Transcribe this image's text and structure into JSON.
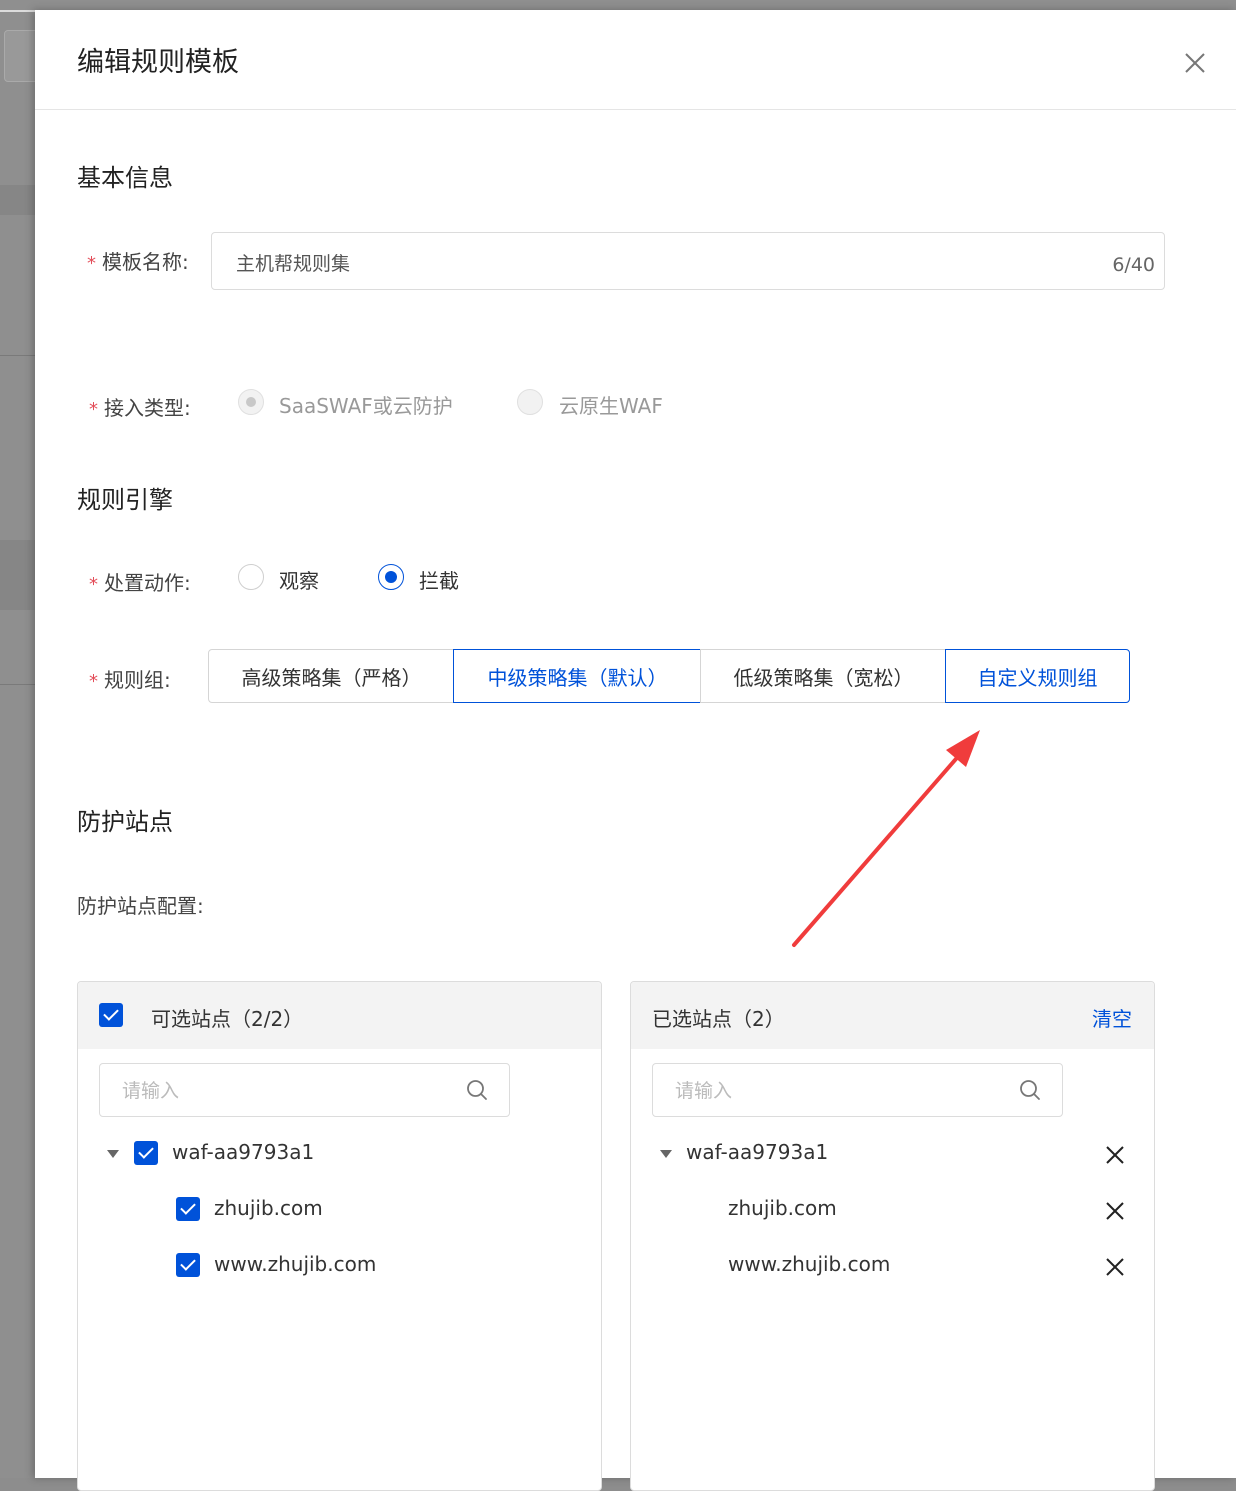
{
  "drawer": {
    "title": "编辑规则模板"
  },
  "basic": {
    "section_title": "基本信息",
    "name_label": "模板名称:",
    "name_value": "主机帮规则集",
    "name_count": "6/40",
    "access_label": "接入类型:",
    "access_options": [
      "SaaSWAF或云防护",
      "云原生WAF"
    ]
  },
  "engine": {
    "section_title": "规则引擎",
    "action_label": "处置动作:",
    "action_options": [
      "观察",
      "拦截"
    ],
    "action_selected": "拦截",
    "group_label": "规则组:",
    "group_options": [
      "高级策略集（严格）",
      "中级策略集（默认）",
      "低级策略集（宽松）",
      "自定义规则组"
    ],
    "group_selected": "中级策略集（默认）"
  },
  "sites": {
    "section_title": "防护站点",
    "config_label": "防护站点配置:",
    "available": {
      "title": "可选站点（2/2）",
      "search_placeholder": "请输入",
      "group": "waf-aa9793a1",
      "items": [
        "zhujib.com",
        "www.zhujib.com"
      ]
    },
    "selected": {
      "title": "已选站点（2）",
      "clear_label": "清空",
      "search_placeholder": "请输入",
      "group": "waf-aa9793a1",
      "items": [
        "zhujib.com",
        "www.zhujib.com"
      ]
    }
  },
  "colors": {
    "primary": "#0052d9",
    "required": "#e34d59",
    "arrow": "#f03c3c"
  }
}
